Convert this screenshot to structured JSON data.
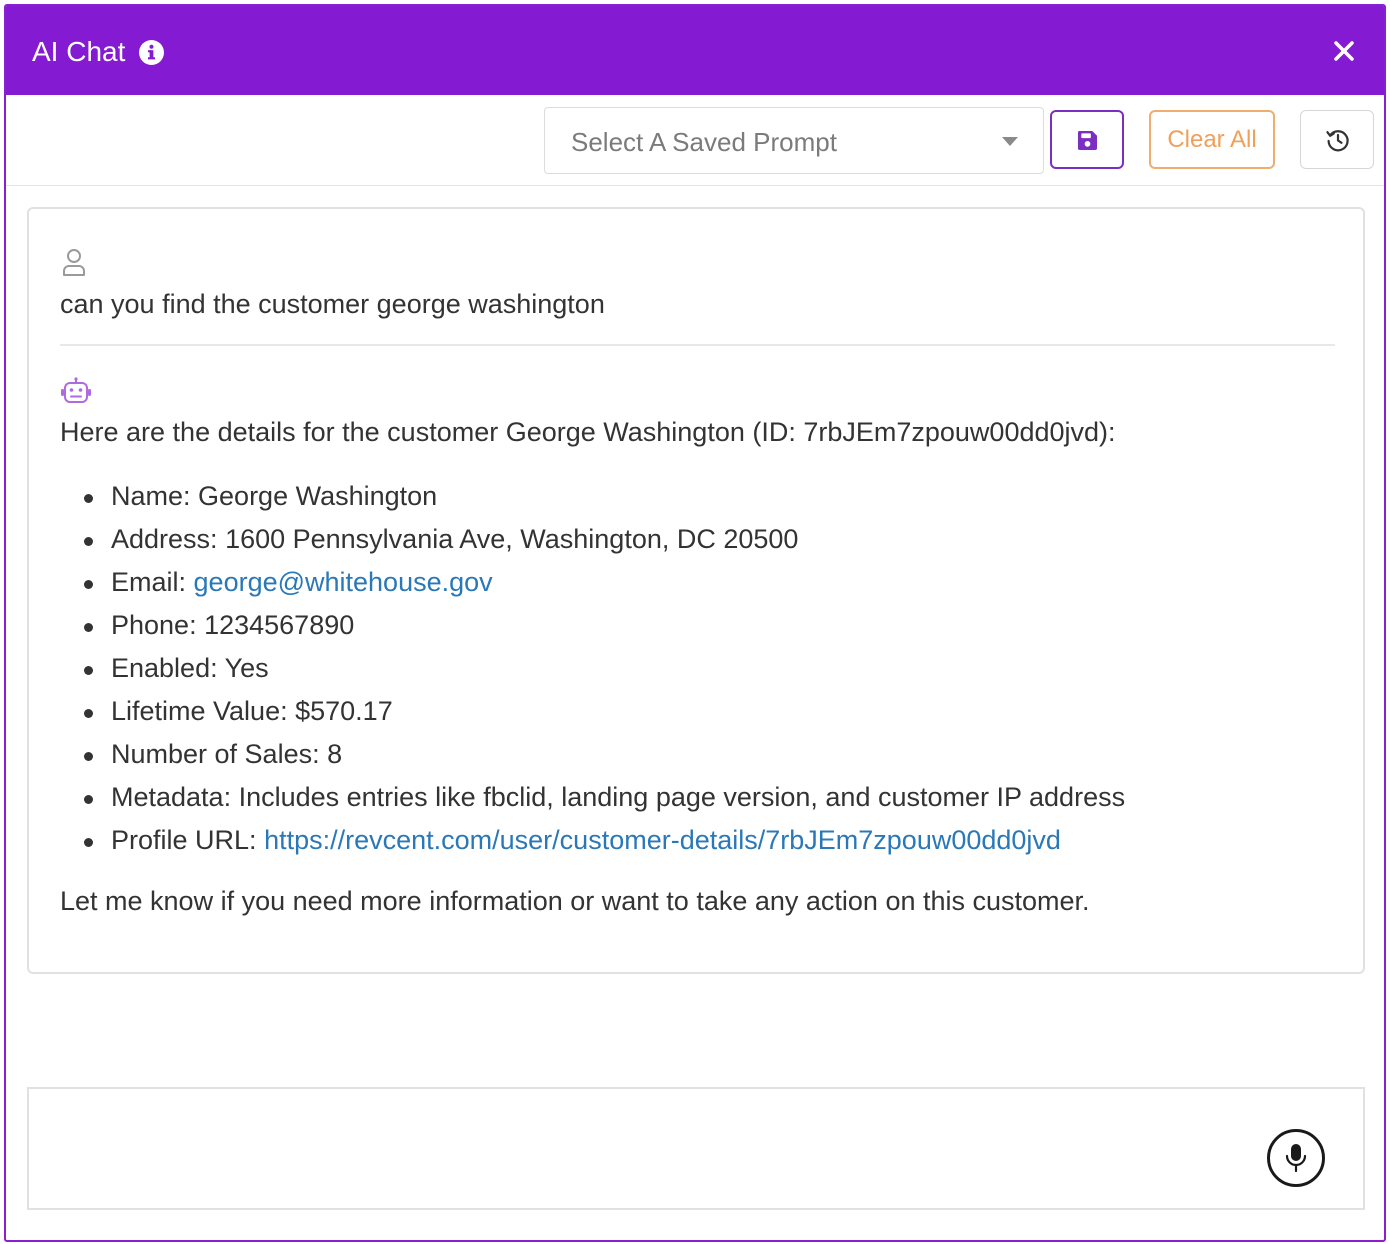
{
  "header": {
    "title": "AI Chat",
    "accent_color": "#841bd2"
  },
  "toolbar": {
    "saved_prompt_placeholder": "Select A Saved Prompt",
    "clear_all_label": "Clear All"
  },
  "chat": {
    "user_message": "can you find the customer george washington",
    "bot_intro": "Here are the details for the customer George Washington (ID: 7rbJEm7zpouw00dd0jvd):",
    "details": [
      {
        "label": "Name: ",
        "value": "George Washington"
      },
      {
        "label": "Address: ",
        "value": "1600 Pennsylvania Ave, Washington, DC 20500"
      },
      {
        "label": "Email: ",
        "link": "george@whitehouse.gov"
      },
      {
        "label": "Phone: ",
        "value": "1234567890"
      },
      {
        "label": "Enabled: ",
        "value": "Yes"
      },
      {
        "label": "Lifetime Value: ",
        "value": "$570.17"
      },
      {
        "label": "Number of Sales: ",
        "value": "8"
      },
      {
        "label": "Metadata: ",
        "value": "Includes entries like fbclid, landing page version, and customer IP address"
      },
      {
        "label": "Profile URL: ",
        "link": "https://revcent.com/user/customer-details/7rbJEm7zpouw00dd0jvd"
      }
    ],
    "bot_outro": "Let me know if you need more information or want to take any action on this customer."
  },
  "input": {
    "value": "",
    "placeholder": ""
  },
  "icons": {
    "info": "info-icon",
    "close": "close-icon",
    "save": "save-icon",
    "history": "history-icon",
    "user": "user-icon",
    "bot": "robot-icon",
    "mic": "microphone-icon"
  },
  "colors": {
    "save_border": "#7b2fc0",
    "clear_border": "#f0ad6e",
    "link": "#2a78b8",
    "bot_icon": "#b06adf"
  }
}
